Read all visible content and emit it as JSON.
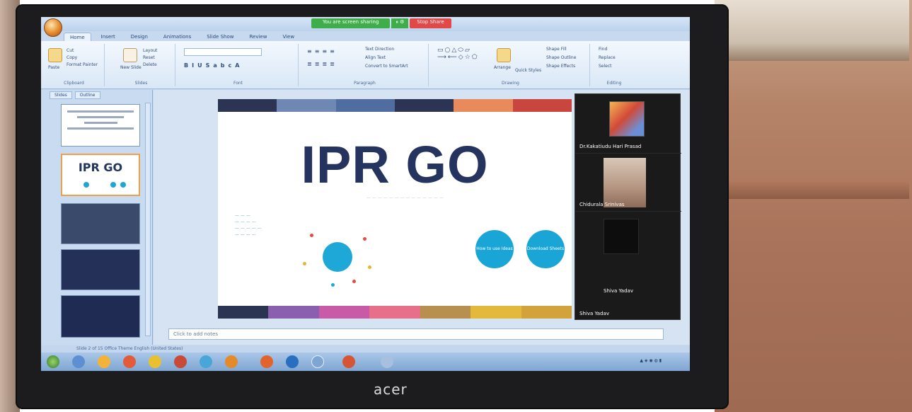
{
  "window": {
    "sharing_banner": "You are screen sharing",
    "stop_share": "Stop Share"
  },
  "ribbon": {
    "tabs": [
      "Home",
      "Insert",
      "Design",
      "Animations",
      "Slide Show",
      "Review",
      "View"
    ],
    "clipboard": {
      "paste": "Paste",
      "cut": "Cut",
      "copy": "Copy",
      "format_painter": "Format Painter",
      "label": "Clipboard"
    },
    "slides_group": {
      "new_slide": "New Slide",
      "layout": "Layout",
      "reset": "Reset",
      "delete": "Delete",
      "label": "Slides"
    },
    "font_label": "Font",
    "paragraph": {
      "text_direction": "Text Direction",
      "align_text": "Align Text",
      "convert_smartart": "Convert to SmartArt",
      "label": "Paragraph"
    },
    "drawing": {
      "arrange": "Arrange",
      "quick_styles": "Quick Styles",
      "shape_fill": "Shape Fill",
      "shape_outline": "Shape Outline",
      "shape_effects": "Shape Effects",
      "label": "Drawing"
    },
    "editing": {
      "find": "Find",
      "replace": "Replace",
      "select": "Select",
      "label": "Editing"
    }
  },
  "slides_pane": {
    "tabs": [
      "Slides",
      "Outline"
    ],
    "thumb2_title": "IPR GO"
  },
  "slide": {
    "title": "IPR GO",
    "cta_left": "How to use Ideas",
    "cta_right": "Download Sheets"
  },
  "participants": [
    {
      "name": "Dr.Kakatiudu Hari Prasad"
    },
    {
      "name": "Chidurala Srinivas"
    },
    {
      "name": "Shiva Yadav",
      "center_label": "Shiva Yadav"
    }
  ],
  "notes": {
    "placeholder": "Click to add notes"
  },
  "status": {
    "text": "Slide 2 of 15   Office Theme   English (United States)"
  },
  "monitor": {
    "brand": "acer"
  },
  "colors": {
    "slide_title": "#25345e",
    "accent_blue": "#1ea8d8",
    "stop_red": "#e24848",
    "share_green": "#3fae4a"
  }
}
